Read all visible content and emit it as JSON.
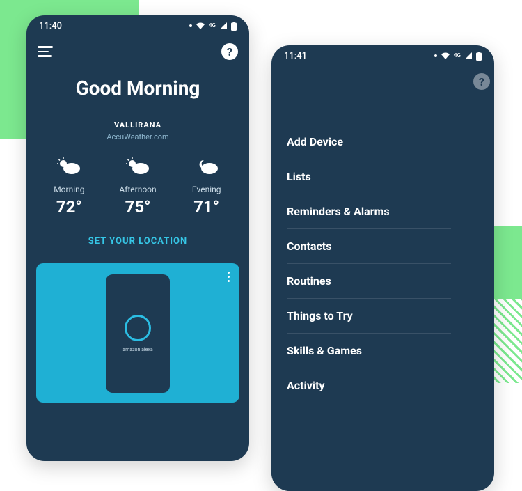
{
  "phone1": {
    "status_time": "11:40",
    "net_label": "4G",
    "greeting": "Good Morning",
    "location_city": "VALLIRANA",
    "location_source": "AccuWeather.com",
    "forecast": [
      {
        "label": "Morning",
        "temp": "72°"
      },
      {
        "label": "Afternoon",
        "temp": "75°"
      },
      {
        "label": "Evening",
        "temp": "71°"
      }
    ],
    "set_location_label": "SET YOUR LOCATION",
    "card_caption": "amazon alexa"
  },
  "phone2": {
    "status_time": "11:41",
    "net_label": "4G",
    "menu_items": [
      "Add Device",
      "Lists",
      "Reminders & Alarms",
      "Contacts",
      "Routines",
      "Things to Try",
      "Skills & Games",
      "Activity"
    ]
  }
}
